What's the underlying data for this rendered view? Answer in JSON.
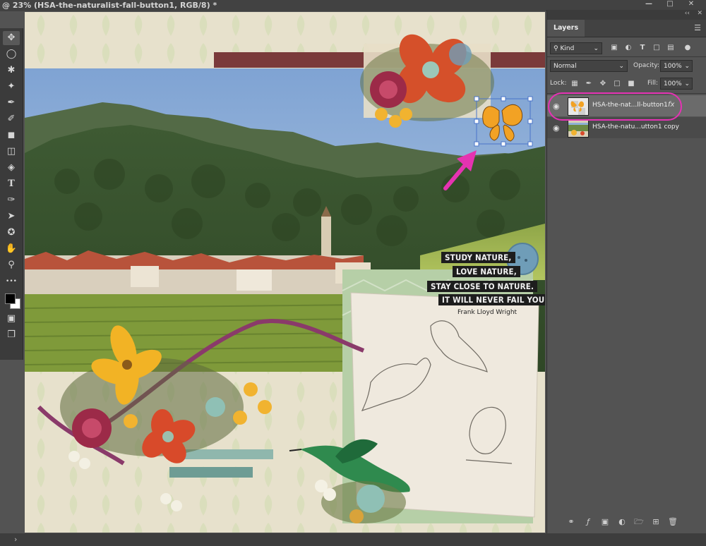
{
  "window": {
    "title": "@ 23% (HSA-the-naturalist-fall-button1, RGB/8) *",
    "controls": [
      "minimize-icon",
      "maximize-icon",
      "close-icon"
    ]
  },
  "toolbar": {
    "tools": [
      "move-icon",
      "ellipse-select-icon",
      "lasso-icon",
      "magic-wand-icon",
      "eyedropper-icon",
      "brush-icon",
      "stamp-icon",
      "eraser-icon",
      "paint-bucket-icon",
      "type-icon",
      "pen-icon",
      "path-select-icon",
      "shape-icon",
      "hand-icon",
      "zoom-icon",
      "more-icon",
      "color-swatches-icon",
      "quick-mask-icon",
      "screen-mode-icon"
    ],
    "tool_glyphs": {
      "type": "T",
      "more": "•••"
    }
  },
  "canvas": {
    "quote_lines": [
      "STUDY NATURE,",
      "LOVE NATURE,",
      "STAY CLOSE TO NATURE.",
      "IT WILL NEVER FAIL YOU."
    ],
    "quote_author": "Frank Lloyd Wright",
    "colors": {
      "paper": "#e6dfcd",
      "sky": "#8fb0d6",
      "mountain": "#3f5a2f",
      "ribbon": "#7a3a3a",
      "transform_box": "#4a74c9",
      "arrow": "#e533b1"
    }
  },
  "layers_panel": {
    "collapse_glyph": "‹‹",
    "close_glyph": "✕",
    "tab_label": "Layers",
    "filter_label": "Kind",
    "blend_mode": "Normal",
    "opacity_label": "Opacity:",
    "opacity_value": "100%",
    "lock_label": "Lock:",
    "fill_label": "Fill:",
    "fill_value": "100%",
    "layers": [
      {
        "name": "HSA-the-nat...ll-button1",
        "selected": true,
        "has_fx": true,
        "fx_label": "fx"
      },
      {
        "name": "HSA-the-natu...utton1 copy",
        "selected": false,
        "has_fx": false
      }
    ],
    "highlight_color": "#e532b4"
  },
  "statusbar": {
    "arrow": "›"
  }
}
